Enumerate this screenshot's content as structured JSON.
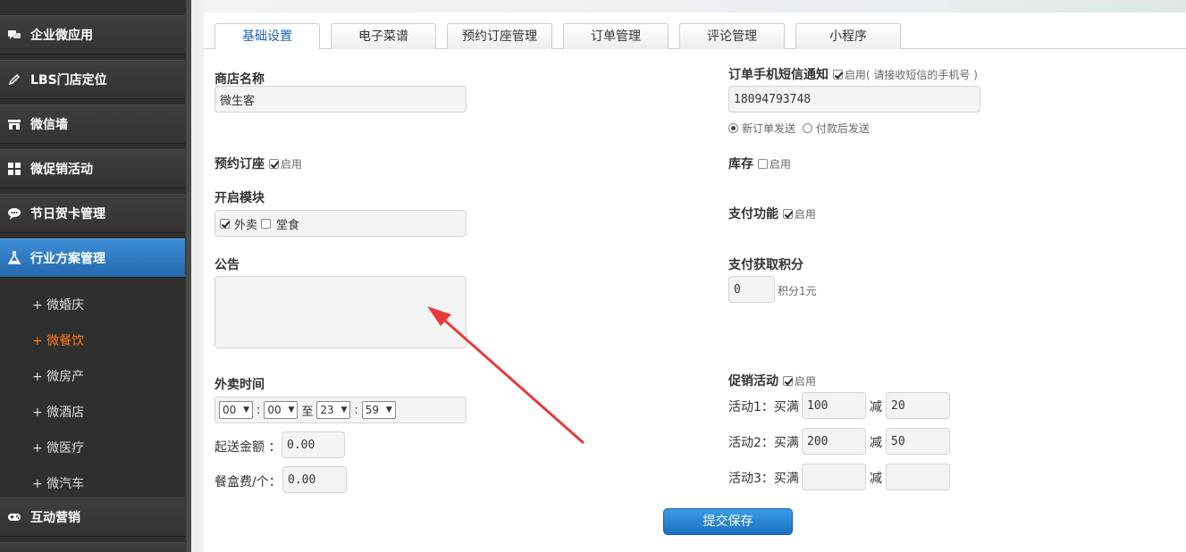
{
  "sidebar": {
    "items": [
      {
        "label": "企业微应用",
        "icon": "chat-bubbles-icon"
      },
      {
        "label": "LBS门店定位",
        "icon": "pencil-icon"
      },
      {
        "label": "微信墙",
        "icon": "store-icon"
      },
      {
        "label": "微促销活动",
        "icon": "grid-icon"
      },
      {
        "label": "节日贺卡管理",
        "icon": "speech-icon"
      },
      {
        "label": "行业方案管理",
        "icon": "flask-icon",
        "active": true
      },
      {
        "label": "互动营销",
        "icon": "gamepad-icon"
      }
    ],
    "sub_items": [
      "+ 微婚庆",
      "+ 微餐饮",
      "+ 微房产",
      "+ 微酒店",
      "+ 微医疗",
      "+ 微汽车"
    ],
    "active_sub": "+ 微餐饮"
  },
  "tabs": [
    "基础设置",
    "电子菜谱",
    "预约订座管理",
    "订单管理",
    "评论管理",
    "小程序"
  ],
  "active_tab": "基础设置",
  "form": {
    "shop_name_label": "商店名称",
    "shop_name_value": "微生客",
    "reservation_label": "预约订座",
    "enable_text": "启用",
    "modules_label": "开启模块",
    "module_takeout": "外卖",
    "module_dinein": "堂食",
    "notice_label": "公告",
    "notice_value": "",
    "takeout_time_label": "外卖时间",
    "time_from_hour": "00",
    "time_from_min": "00",
    "time_to_text": "至",
    "time_to_hour": "23",
    "time_to_min": "59",
    "colon": ":",
    "min_amount_label": "起送金额 ：",
    "min_amount_value": "0.00",
    "box_fee_label": "餐盒费/个：",
    "box_fee_value": "0.00",
    "sms_label": "订单手机短信通知",
    "sms_hint": "( 请接收短信的手机号 )",
    "sms_phone": "18094793748",
    "radio_new_order": "新订单发送",
    "radio_after_pay": "付款后发送",
    "stock_label": "库存",
    "payment_label": "支付功能",
    "points_label": "支付获取积分",
    "points_value": "0",
    "points_unit": "积分1元",
    "promo_label": "促销活动",
    "promo_rows": [
      {
        "label": "活动1：买满",
        "full": "100",
        "minus": "减",
        "cut": "20"
      },
      {
        "label": "活动2：买满",
        "full": "200",
        "minus": "减",
        "cut": "50"
      },
      {
        "label": "活动3：买满",
        "full": "",
        "minus": "减",
        "cut": ""
      }
    ],
    "submit_label": "提交保存"
  },
  "colors": {
    "sidebar_bg": "#2f2f2f",
    "active_nav": "#2a76c0",
    "active_sub": "#ff7a1a",
    "button": "#1b6fc3",
    "arrow": "#e83a3a"
  }
}
